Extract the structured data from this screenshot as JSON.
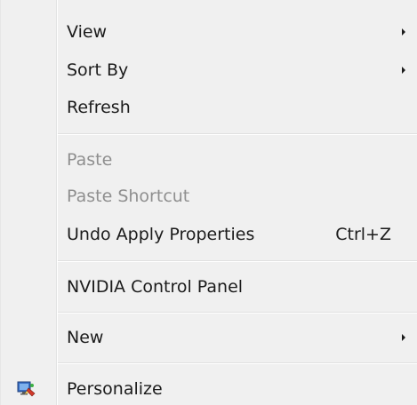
{
  "menu": {
    "items": {
      "view": {
        "label": "View",
        "submenu": true
      },
      "sort_by": {
        "label": "Sort By",
        "submenu": true
      },
      "refresh": {
        "label": "Refresh"
      },
      "paste": {
        "label": "Paste",
        "disabled": true
      },
      "paste_shortcut": {
        "label": "Paste Shortcut",
        "disabled": true
      },
      "undo": {
        "label": "Undo Apply Properties",
        "shortcut": "Ctrl+Z"
      },
      "nvidia": {
        "label": "NVIDIA Control Panel"
      },
      "new": {
        "label": "New",
        "submenu": true
      },
      "personalize": {
        "label": "Personalize",
        "icon": "personalize-icon"
      }
    }
  },
  "colors": {
    "background": "#f0f0f0",
    "text": "#1b1b1b",
    "disabled_text": "#8f8f8f",
    "separator": "#e0e0e0"
  }
}
